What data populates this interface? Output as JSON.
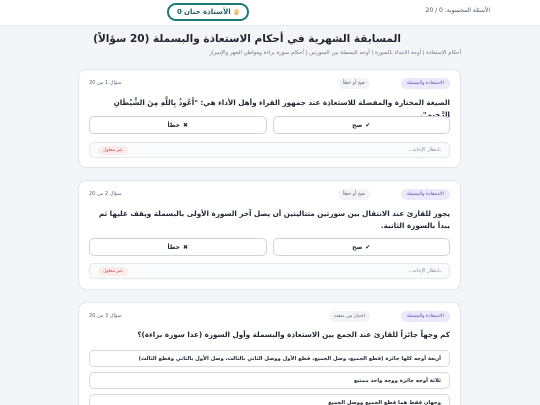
{
  "topbar": {
    "answered_label": "الأسئلة المحسوبة: 0 / 20",
    "user_name": "الأستاذة حنان",
    "user_score": "0"
  },
  "header": {
    "title": "المسابقة الشهرية في أحكام الاستعاذة والبسملة (20 سؤالاً)",
    "subtitle": "أحكام الاستعاذة | أوجه الابتداء بالسورة | أوجه البسملة بين السورتين | أحكام سورة براءة ومواطن الجهر والإسرار"
  },
  "questions": [
    {
      "category": "الاستعاذة والبسملة",
      "type": "صح أو خطأ",
      "counter": "سؤال 1 من 20",
      "text": "الصيغة المختارة والمفضلة للاستعاذة عند جمهور القراء وأهل الأداء هي: \"أَعُوذُ بِاللَّهِ مِنَ الشَّيْطَانِ الرَّجِيمِ\".",
      "true_label": "صح",
      "false_label": "خطأ",
      "status": "بانتظار الإجابة...",
      "unanswered": "غير محلول"
    },
    {
      "category": "الاستعاذة والبسملة",
      "type": "صح أو خطأ",
      "counter": "سؤال 2 من 20",
      "text": "يجوز للقارئ عند الانتقال بين سورتين متتاليتين أن يصل آخر السورة الأولى بالبسملة ويقف عليها ثم يبدأ بالسورة الثانية.",
      "true_label": "صح",
      "false_label": "خطأ",
      "status": "بانتظار الإجابة...",
      "unanswered": "غير محلول"
    },
    {
      "category": "الاستعاذة والبسملة",
      "type": "اختيار من متعدد",
      "counter": "سؤال 3 من 20",
      "text": "كم وجهاً جائزاً للقارئ عند الجمع بين الاستعاذة والبسملة وأول السورة (عدا سورة براءة)؟",
      "options": [
        "أربعة أوجه كلها جائزة (قطع الجميع، وصل الجميع، قطع الأول ووصل الثاني بالثالث، وصل الأول بالثاني وقطع الثالث)",
        "ثلاثة أوجه جائزة ووجه واحد ممتنع",
        "وجهان فقط هما قطع الجميع ووصل الجميع"
      ]
    }
  ],
  "colors": {
    "accent": "#1e7b74",
    "category_badge": "#5a48b8",
    "unanswered": "#d23b3b",
    "background": "#f4f5f8"
  }
}
